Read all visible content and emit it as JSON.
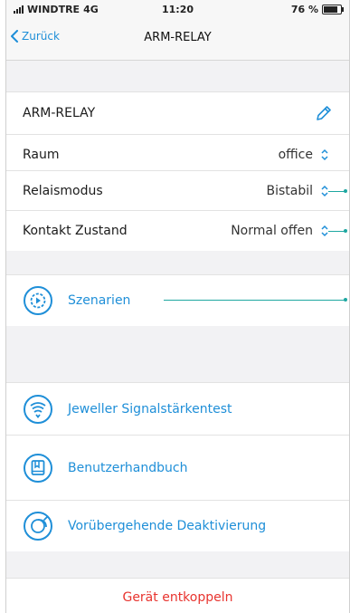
{
  "status_bar": {
    "carrier": "WINDTRE",
    "network": "4G",
    "time": "11:20",
    "battery": "76 %"
  },
  "nav": {
    "back_label": "Zurück",
    "title": "ARM-RELAY"
  },
  "device": {
    "name": "ARM-RELAY"
  },
  "settings": {
    "room": {
      "label": "Raum",
      "value": "office"
    },
    "relay_mode": {
      "label": "Relaismodus",
      "value": "Bistabil"
    },
    "contact_state": {
      "label": "Kontakt Zustand",
      "value": "Normal offen"
    }
  },
  "actions": {
    "scenarios": "Szenarien",
    "signal_test": "Jeweller Signalstärkentest",
    "manual": "Benutzerhandbuch",
    "temp_deactivation": "Vorübergehende Deaktivierung",
    "unpair": "Gerät entkoppeln"
  },
  "colors": {
    "accent": "#1f8fd8",
    "danger": "#e8342f",
    "callout": "#1ea7a1"
  }
}
